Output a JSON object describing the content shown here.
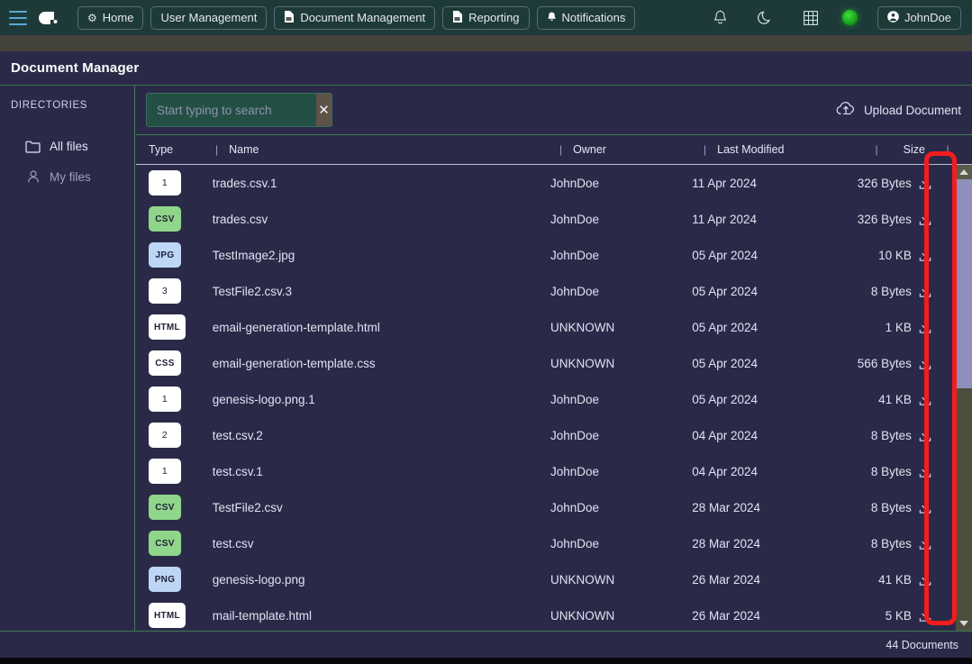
{
  "topnav": {
    "menu_icon": "hamburger-icon",
    "logo_icon": "app-logo-icon",
    "buttons": [
      {
        "label": "Home",
        "icon": "gear-icon"
      },
      {
        "label": "User Management",
        "icon": ""
      },
      {
        "label": "Document Management",
        "icon": "document-icon"
      },
      {
        "label": "Reporting",
        "icon": "document-icon"
      },
      {
        "label": "Notifications",
        "icon": "bell-icon"
      }
    ],
    "icons": [
      {
        "name": "bell-icon"
      },
      {
        "name": "moon-icon"
      },
      {
        "name": "grid-icon"
      },
      {
        "name": "status-dot-icon"
      }
    ],
    "user": {
      "label": "JohnDoe",
      "icon": "user-circle-icon"
    }
  },
  "header": {
    "title": "Document Manager"
  },
  "sidebar": {
    "section_label": "DIRECTORIES",
    "items": [
      {
        "label": "All files",
        "icon": "folder-icon",
        "active": true
      },
      {
        "label": "My files",
        "icon": "person-icon",
        "active": false
      }
    ]
  },
  "toolbar": {
    "search": {
      "value": "",
      "placeholder": "Start typing to search"
    },
    "clear_label": "✕",
    "upload_label": "Upload Document",
    "upload_icon": "cloud-upload-icon"
  },
  "table": {
    "columns": [
      {
        "key": "type",
        "label": "Type"
      },
      {
        "key": "name",
        "label": "Name"
      },
      {
        "key": "owner",
        "label": "Owner"
      },
      {
        "key": "modified",
        "label": "Last Modified"
      },
      {
        "key": "size",
        "label": "Size"
      }
    ],
    "separator": "|",
    "row_action_icon": "download-icon",
    "rows": [
      {
        "badge": "1",
        "badge_style": "white",
        "name": "trades.csv.1",
        "owner": "JohnDoe",
        "modified": "11 Apr 2024",
        "size": "326 Bytes"
      },
      {
        "badge": "CSV",
        "badge_style": "green",
        "name": "trades.csv",
        "owner": "JohnDoe",
        "modified": "11 Apr 2024",
        "size": "326 Bytes"
      },
      {
        "badge": "JPG",
        "badge_style": "blue",
        "name": "TestImage2.jpg",
        "owner": "JohnDoe",
        "modified": "05 Apr 2024",
        "size": "10 KB"
      },
      {
        "badge": "3",
        "badge_style": "white",
        "name": "TestFile2.csv.3",
        "owner": "JohnDoe",
        "modified": "05 Apr 2024",
        "size": "8 Bytes"
      },
      {
        "badge": "HTML",
        "badge_style": "white",
        "name": "email-generation-template.html",
        "owner": "UNKNOWN",
        "modified": "05 Apr 2024",
        "size": "1 KB"
      },
      {
        "badge": "CSS",
        "badge_style": "white",
        "name": "email-generation-template.css",
        "owner": "UNKNOWN",
        "modified": "05 Apr 2024",
        "size": "566 Bytes"
      },
      {
        "badge": "1",
        "badge_style": "white",
        "name": "genesis-logo.png.1",
        "owner": "JohnDoe",
        "modified": "05 Apr 2024",
        "size": "41 KB"
      },
      {
        "badge": "2",
        "badge_style": "white",
        "name": "test.csv.2",
        "owner": "JohnDoe",
        "modified": "04 Apr 2024",
        "size": "8 Bytes"
      },
      {
        "badge": "1",
        "badge_style": "white",
        "name": "test.csv.1",
        "owner": "JohnDoe",
        "modified": "04 Apr 2024",
        "size": "8 Bytes"
      },
      {
        "badge": "CSV",
        "badge_style": "green",
        "name": "TestFile2.csv",
        "owner": "JohnDoe",
        "modified": "28 Mar 2024",
        "size": "8 Bytes"
      },
      {
        "badge": "CSV",
        "badge_style": "green",
        "name": "test.csv",
        "owner": "JohnDoe",
        "modified": "28 Mar 2024",
        "size": "8 Bytes"
      },
      {
        "badge": "PNG",
        "badge_style": "blue",
        "name": "genesis-logo.png",
        "owner": "UNKNOWN",
        "modified": "26 Mar 2024",
        "size": "41 KB"
      },
      {
        "badge": "HTML",
        "badge_style": "white",
        "name": "mail-template.html",
        "owner": "UNKNOWN",
        "modified": "26 Mar 2024",
        "size": "5 KB"
      }
    ]
  },
  "footer": {
    "count_label": "44 Documents"
  },
  "colors": {
    "topnav_bg": "#1d3a38",
    "page_bg": "#2a2a48",
    "divider_green": "#3e7a51",
    "search_bg": "#235044",
    "badge_green": "#8fd58a",
    "badge_blue": "#bdd6f5",
    "annotation_red": "#f41c1c",
    "status_dot": "#22c522"
  }
}
